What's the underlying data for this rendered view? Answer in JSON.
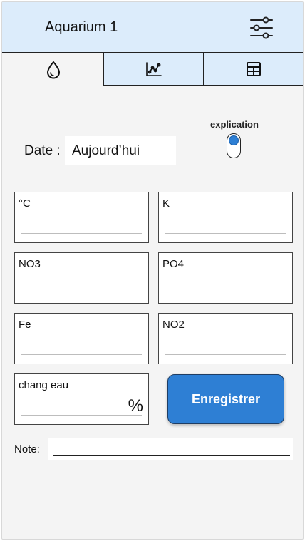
{
  "header": {
    "title": "Aquarium 1",
    "settings_icon": "sliders-icon"
  },
  "tabs": [
    {
      "icon": "water-drop-icon",
      "active": true
    },
    {
      "icon": "line-chart-icon",
      "active": false
    },
    {
      "icon": "table-icon",
      "active": false
    }
  ],
  "date": {
    "label": "Date :",
    "value": "Aujourd’hui"
  },
  "explication": {
    "label": "explication",
    "state": "on"
  },
  "measurements": [
    {
      "label": "°C",
      "value": ""
    },
    {
      "label": "K",
      "value": ""
    },
    {
      "label": "NO3",
      "value": ""
    },
    {
      "label": "PO4",
      "value": ""
    },
    {
      "label": "Fe",
      "value": ""
    },
    {
      "label": "NO2",
      "value": ""
    },
    {
      "label": "chang eau",
      "value": "",
      "unit": "%"
    }
  ],
  "save_button": {
    "label": "Enregistrer"
  },
  "note": {
    "label": "Note:",
    "value": ""
  },
  "colors": {
    "header_bg": "#dcecfb",
    "accent": "#2e7fd4",
    "page_bg": "#f4f4f4"
  }
}
